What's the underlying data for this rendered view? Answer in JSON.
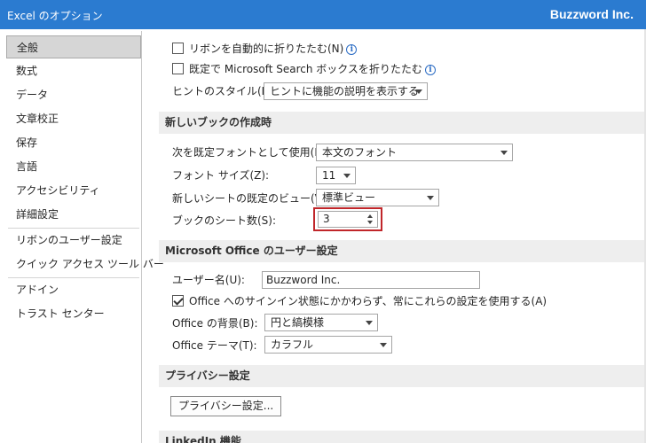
{
  "window": {
    "title": "Excel のオプション",
    "brand": "Buzzword Inc."
  },
  "sidebar": {
    "items": [
      {
        "label": "全般"
      },
      {
        "label": "数式"
      },
      {
        "label": "データ"
      },
      {
        "label": "文章校正"
      },
      {
        "label": "保存"
      },
      {
        "label": "言語"
      },
      {
        "label": "アクセシビリティ"
      },
      {
        "label": "詳細設定"
      },
      {
        "label": "リボンのユーザー設定"
      },
      {
        "label": "クイック アクセス ツール バー"
      },
      {
        "label": "アドイン"
      },
      {
        "label": "トラスト センター"
      }
    ],
    "selected": "全般"
  },
  "ui_options": {
    "collapse_ribbon_label": "リボンを自動的に折りたたむ(N)",
    "collapse_ribbon_checked": false,
    "collapse_search_label": "既定で Microsoft Search ボックスを折りたたむ",
    "collapse_search_checked": false,
    "tooltip_label": "ヒントのスタイル(R):",
    "tooltip_value": "ヒントに機能の説明を表示する"
  },
  "new_workbook": {
    "header": "新しいブックの作成時",
    "font_label": "次を既定フォントとして使用(N):",
    "font_value": "本文のフォント",
    "size_label": "フォント サイズ(Z):",
    "size_value": "11",
    "view_label": "新しいシートの既定のビュー(V):",
    "view_value": "標準ビュー",
    "sheets_label": "ブックのシート数(S):",
    "sheets_value": "3"
  },
  "personalize": {
    "header": "Microsoft Office のユーザー設定",
    "username_label": "ユーザー名(U):",
    "username_value": "Buzzword Inc.",
    "always_use_label": "Office へのサインイン状態にかかわらず、常にこれらの設定を使用する(A)",
    "always_use_checked": true,
    "background_label": "Office の背景(B):",
    "background_value": "円と縞模様",
    "theme_label": "Office テーマ(T):",
    "theme_value": "カラフル"
  },
  "privacy": {
    "header": "プライバシー設定",
    "button_label": "プライバシー設定..."
  },
  "linkedin": {
    "header": "LinkedIn 機能"
  },
  "icons": {
    "info": "i"
  },
  "colors": {
    "titlebar": "#2b7bd0",
    "highlight": "#c0262a",
    "section": "#eeeeee"
  }
}
